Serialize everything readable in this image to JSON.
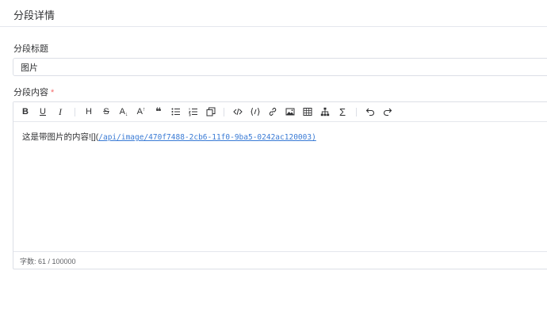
{
  "header": {
    "title": "分段详情"
  },
  "form": {
    "title_label": "分段标题",
    "title_value": "图片",
    "content_label": "分段内容",
    "required_mark": "*"
  },
  "editor": {
    "toolbar": {
      "bold": "B",
      "underline": "U",
      "italic": "I",
      "heading": "H",
      "strike": "S",
      "subscript": "A",
      "subscript_mark": "↓",
      "superscript": "A",
      "superscript_mark": "↑",
      "quote": "❝",
      "sigma": "Σ"
    },
    "content_text": "这是带图片的内容![](",
    "content_link": "/api/image/470f7488-2cb6-11f0-9ba5-0242ac120003",
    "content_close": ")",
    "status": "字数: 61 / 100000"
  },
  "colors": {
    "accent": "#3a7bd5",
    "required": "#f56c6c",
    "border": "#dcdfe6"
  }
}
